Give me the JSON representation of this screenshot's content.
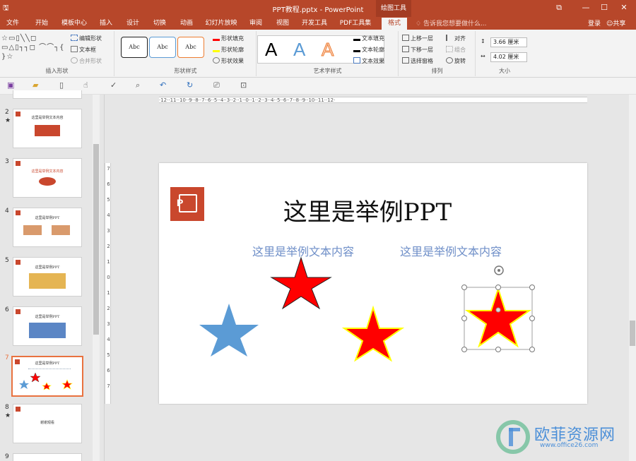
{
  "titlebar": {
    "title": "PPT教程.pptx - PowerPoint",
    "context_tab": "绘图工具",
    "restore": "⧉",
    "minimize": "—",
    "maximize": "☐",
    "close": "✕",
    "qat_icons": [
      "save-icon",
      "undo-icon",
      "redo-icon"
    ]
  },
  "tabs": [
    "文件",
    "开始",
    "模板中心",
    "插入",
    "设计",
    "切换",
    "动画",
    "幻灯片放映",
    "审阅",
    "视图",
    "开发工具",
    "PDF工具集",
    "格式"
  ],
  "active_tab": "格式",
  "tell_me": "告诉我您想要做什么...",
  "login": "登录",
  "share": "共享",
  "ribbon": {
    "insert_shapes": {
      "label": "插入形状",
      "edit_shape": "编辑形状",
      "text_box": "文本框",
      "merge_shapes": "合并形状",
      "shapes_glyphs": "☆▭▯╲╲◻ ▭△▯┐┐◻ ⌒⌒┐{ }☆"
    },
    "shape_styles": {
      "label": "形状样式",
      "swatches": [
        "Abc",
        "Abc",
        "Abc"
      ],
      "fill": "形状填充",
      "outline": "形状轮廓",
      "effects": "形状效果"
    },
    "wordart_styles": {
      "label": "艺术字样式",
      "samples": [
        "A",
        "A",
        "A"
      ],
      "text_fill": "文本填充",
      "text_outline": "文本轮廓",
      "text_effects": "文本效果"
    },
    "arrange": {
      "label": "排列",
      "bring_forward": "上移一层",
      "send_backward": "下移一层",
      "selection_pane": "选择窗格",
      "align": "对齐",
      "group": "组合",
      "rotate": "旋转"
    },
    "size": {
      "label": "大小",
      "height": "3.66 厘米",
      "width": "4.02 厘米"
    }
  },
  "slides": [
    {
      "number": "2",
      "star": "★",
      "title": "这里是举例文本内容"
    },
    {
      "number": "3",
      "star": "",
      "title": "这里是举例文本内容"
    },
    {
      "number": "4",
      "star": "",
      "title": "这里是举例PPT"
    },
    {
      "number": "5",
      "star": "",
      "title": "这里是举例PPT"
    },
    {
      "number": "6",
      "star": "",
      "title": "这里是举例PPT"
    },
    {
      "number": "7",
      "star": "",
      "title": "这里是举例PPT",
      "selected": true
    },
    {
      "number": "8",
      "star": "★",
      "title": "谢谢观看"
    },
    {
      "number": "9",
      "star": "",
      "title": ""
    }
  ],
  "ruler": {
    "h_labels": "·12··11··10··9··8··7··6··5··4··3··2··1··0··1··2··3··4··5··6··7··8··9··10··11··12·",
    "v_labels": [
      "7",
      "6",
      "5",
      "4",
      "3",
      "2",
      "1",
      "0",
      "1",
      "2",
      "3",
      "4",
      "5",
      "6",
      "7"
    ]
  },
  "slide": {
    "title": "这里是举例PPT",
    "subtitle_left": "这里是举例文本内容",
    "subtitle_right": "这里是举例文本内容",
    "logo_letter": "P"
  },
  "colors": {
    "accent": "#b7472a",
    "star_red": "#ff0000",
    "star_blue": "#5b9bd5",
    "star_outline_yellow": "#ffff00",
    "subtitle_blue": "#6f8fc8"
  },
  "watermark": {
    "text": "欧菲资源网",
    "url": "www.office26.com"
  }
}
